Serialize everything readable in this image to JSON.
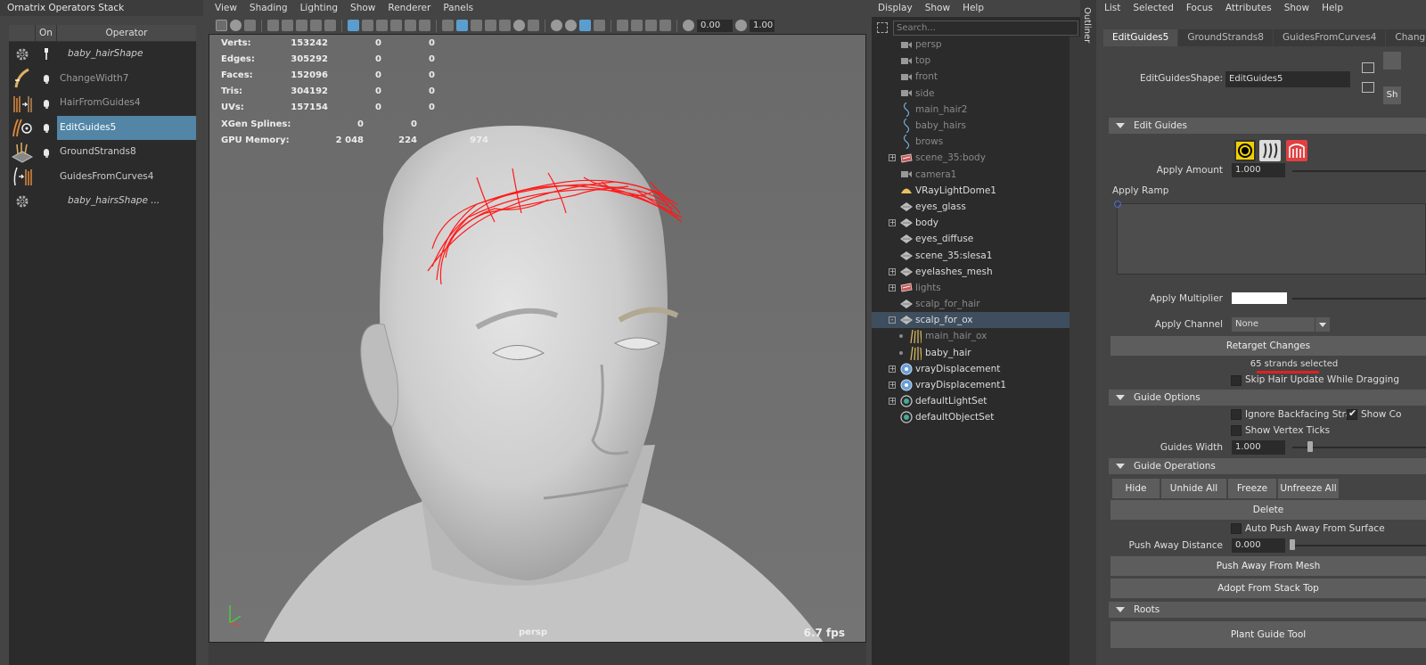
{
  "ops_panel": {
    "title": "Ornatrix Operators Stack",
    "headers": [
      "On",
      "Operator"
    ],
    "rows": [
      {
        "name": "baby_hairShape",
        "style": "italic",
        "icon": "gear-icon"
      },
      {
        "name": "ChangeWidth7",
        "style": "dim",
        "icon": "change-width-icon"
      },
      {
        "name": "HairFromGuides4",
        "style": "dim",
        "icon": "hair-from-guides-icon"
      },
      {
        "name": "EditGuides5",
        "style": "selected",
        "icon": "edit-guides-icon"
      },
      {
        "name": "GroundStrands8",
        "style": "normal",
        "icon": "ground-strands-icon"
      },
      {
        "name": "GuidesFromCurves4",
        "style": "normal",
        "icon": "guides-from-curves-icon"
      },
      {
        "name": "baby_hairsShape ...",
        "style": "italic",
        "icon": "gear-icon"
      }
    ]
  },
  "viewport": {
    "menu": [
      "View",
      "Shading",
      "Lighting",
      "Show",
      "Renderer",
      "Panels"
    ],
    "field1": "0.00",
    "field2": "1.00",
    "hud": [
      {
        "k": "Verts:",
        "v": "153242",
        "v2": "0",
        "v3": "0"
      },
      {
        "k": "Edges:",
        "v": "305292",
        "v2": "0",
        "v3": "0"
      },
      {
        "k": "Faces:",
        "v": "152096",
        "v2": "0",
        "v3": "0"
      },
      {
        "k": "Tris:",
        "v": "304192",
        "v2": "0",
        "v3": "0"
      },
      {
        "k": "UVs:",
        "v": "157154",
        "v2": "0",
        "v3": "0"
      },
      {
        "k": "XGen Splines:",
        "v": "0",
        "v2": "0",
        "v3": ""
      },
      {
        "k": "GPU Memory:",
        "v": "2 048",
        "v2": "224",
        "v3": "974"
      }
    ],
    "camera": "persp",
    "fps": "6.7 fps",
    "accent_curve_color": "#ff1a1a"
  },
  "outliner": {
    "menu": [
      "Display",
      "Show",
      "Help"
    ],
    "search_placeholder": "Search...",
    "tab_label": "Outliner",
    "items": [
      {
        "name": "persp",
        "icon": "camera-icon",
        "dim": true
      },
      {
        "name": "top",
        "icon": "camera-icon",
        "dim": true
      },
      {
        "name": "front",
        "icon": "camera-icon",
        "dim": true
      },
      {
        "name": "side",
        "icon": "camera-icon",
        "dim": true
      },
      {
        "name": "main_hair2",
        "icon": "curve-icon",
        "dim": true
      },
      {
        "name": "baby_hairs",
        "icon": "curve-icon",
        "dim": true
      },
      {
        "name": "brows",
        "icon": "curve-icon",
        "dim": true
      },
      {
        "name": "scene_35:body",
        "icon": "group-icon",
        "dim": true,
        "expander": "+"
      },
      {
        "name": "camera1",
        "icon": "camera-icon",
        "dim": true
      },
      {
        "name": "VRayLightDome1",
        "icon": "dome-light-icon",
        "dim": false
      },
      {
        "name": "eyes_glass",
        "icon": "mesh-icon",
        "dim": false
      },
      {
        "name": "body",
        "icon": "mesh-icon",
        "dim": false,
        "expander": "+"
      },
      {
        "name": "eyes_diffuse",
        "icon": "mesh-icon",
        "dim": false
      },
      {
        "name": "scene_35:slesa1",
        "icon": "mesh-icon",
        "dim": false
      },
      {
        "name": "eyelashes_mesh",
        "icon": "mesh-icon",
        "dim": false,
        "expander": "+"
      },
      {
        "name": "lights",
        "icon": "group-icon",
        "dim": true,
        "expander": "+"
      },
      {
        "name": "scalp_for_hair",
        "icon": "mesh-icon",
        "dim": true
      },
      {
        "name": "scalp_for_ox",
        "icon": "mesh-icon",
        "dim": false,
        "expander": "-",
        "selected": true
      },
      {
        "name": "main_hair_ox",
        "icon": "hair-icon",
        "dim": true,
        "child": true
      },
      {
        "name": "baby_hair",
        "icon": "hair-icon",
        "dim": false,
        "child": true
      },
      {
        "name": "vrayDisplacement",
        "icon": "displacement-icon",
        "dim": false,
        "expander": "+"
      },
      {
        "name": "vrayDisplacement1",
        "icon": "displacement-icon",
        "dim": false,
        "expander": "+"
      },
      {
        "name": "defaultLightSet",
        "icon": "set-icon",
        "dim": false,
        "expander": "+"
      },
      {
        "name": "defaultObjectSet",
        "icon": "set-icon",
        "dim": false
      }
    ]
  },
  "attr_editor": {
    "menu": [
      "List",
      "Selected",
      "Focus",
      "Attributes",
      "Show",
      "Help"
    ],
    "tabs": [
      "EditGuides5",
      "GroundStrands8",
      "GuidesFromCurves4",
      "Chang"
    ],
    "shape_label": "EditGuidesShape:",
    "shape_value": "EditGuides5",
    "side_button": "Sh",
    "edit_guides": {
      "title": "Edit Guides",
      "apply_amount_label": "Apply Amount",
      "apply_amount": "1.000",
      "apply_ramp_label": "Apply Ramp",
      "apply_multiplier_label": "Apply Multiplier",
      "apply_channel_label": "Apply Channel",
      "apply_channel": "None",
      "retarget_button": "Retarget Changes",
      "status": "65 strands selected",
      "skip_label": "Skip Hair Update While Dragging"
    },
    "guide_options": {
      "title": "Guide Options",
      "ignore_backfacing": "Ignore Backfacing Strar",
      "show_co": "Show Co",
      "show_vertex_ticks": "Show Vertex Ticks",
      "guides_width_label": "Guides Width",
      "guides_width": "1.000"
    },
    "guide_operations": {
      "title": "Guide Operations",
      "buttons": [
        "Hide",
        "Unhide All",
        "Freeze",
        "Unfreeze All"
      ],
      "delete": "Delete",
      "auto_push": "Auto Push Away From Surface",
      "push_distance_label": "Push Away Distance",
      "push_distance": "0.000",
      "push_button": "Push Away From Mesh",
      "adopt_button": "Adopt From Stack Top"
    },
    "roots": {
      "title": "Roots",
      "plant_button": "Plant Guide Tool"
    }
  }
}
